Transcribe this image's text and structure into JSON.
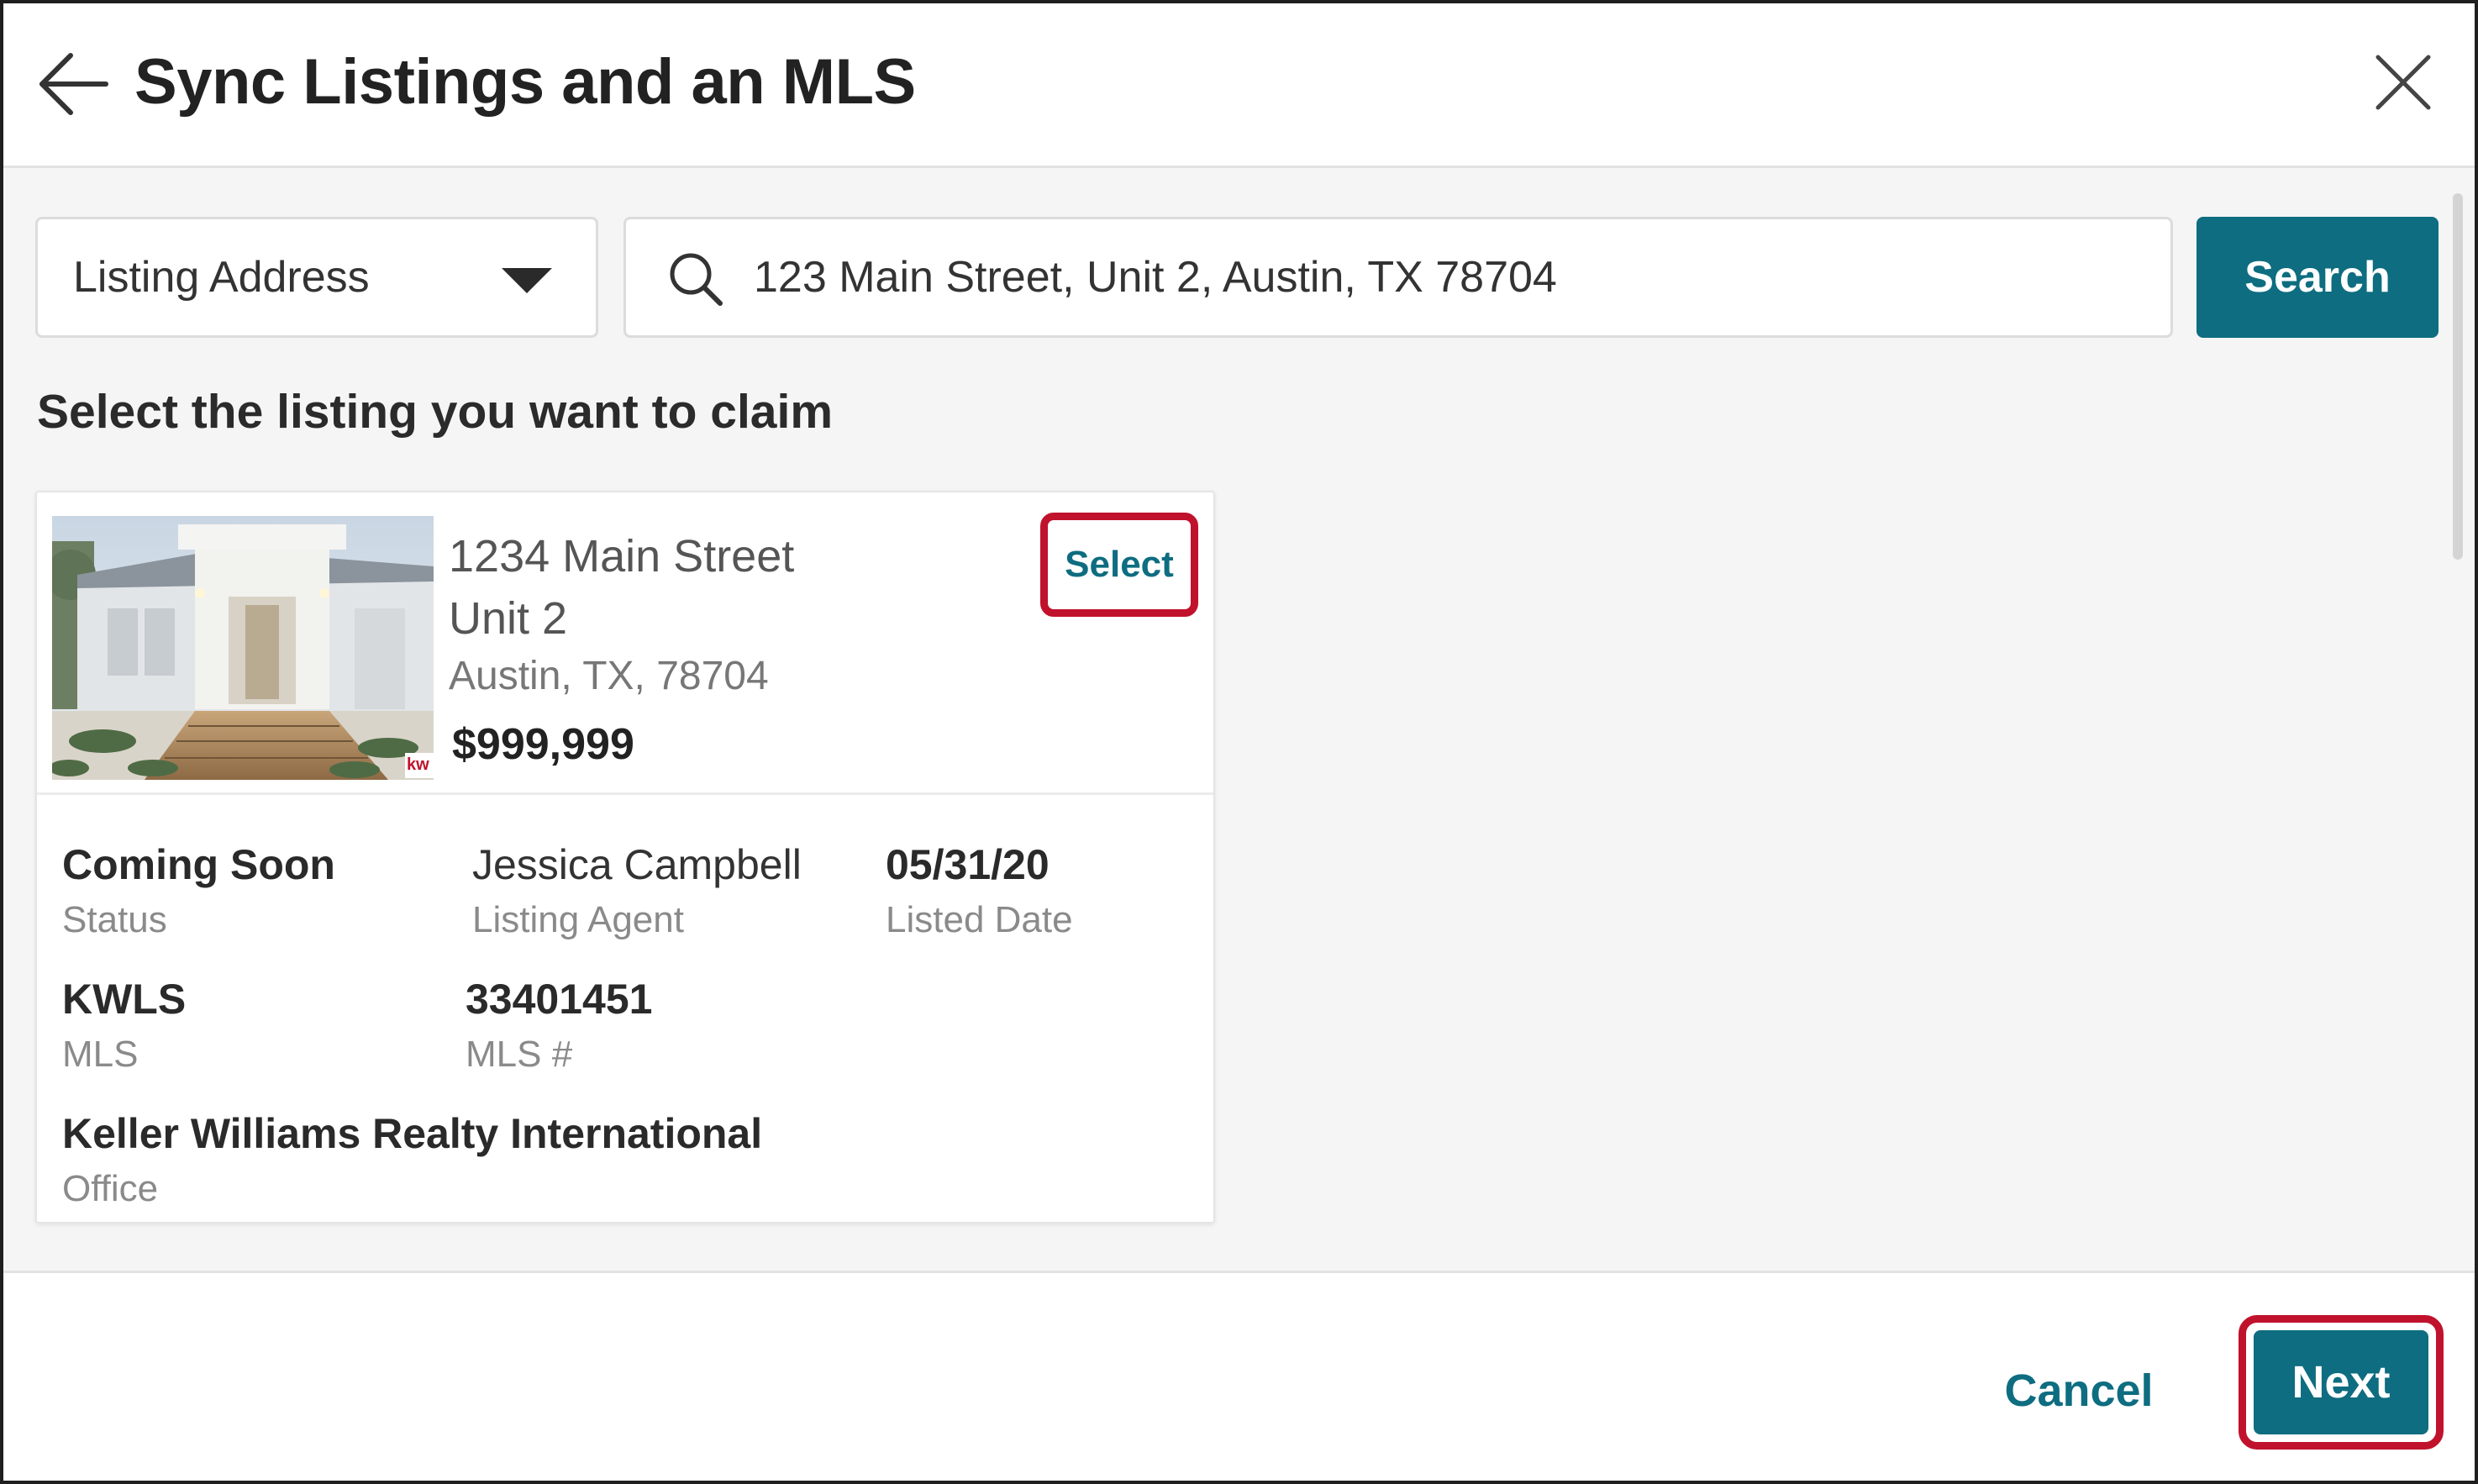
{
  "dialog": {
    "title": "Sync Listings and an MLS",
    "back_icon": "arrow-left-icon",
    "close_icon": "close-icon"
  },
  "search": {
    "filter_selected": "Listing Address",
    "query": "123 Main Street, Unit 2, Austin, TX 78704",
    "button_label": "Search"
  },
  "instruction": "Select the listing you want to claim",
  "listing": {
    "address_line1": "1234 Main Street",
    "address_line2": "Unit 2",
    "city_state_zip": "Austin, TX, 78704",
    "price": "$999,999",
    "select_label": "Select",
    "photo_badge": "kw",
    "details": {
      "status": {
        "value": "Coming Soon",
        "label": "Status"
      },
      "agent": {
        "value": "Jessica Campbell",
        "label": "Listing Agent"
      },
      "listed_date": {
        "value": "05/31/20",
        "label": "Listed Date"
      },
      "mls": {
        "value": "KWLS",
        "label": "MLS"
      },
      "mls_number": {
        "value": "33401451",
        "label": "MLS #"
      },
      "office": {
        "value": "Keller Williams Realty International",
        "label": "Office"
      }
    }
  },
  "footer": {
    "cancel_label": "Cancel",
    "next_label": "Next"
  },
  "colors": {
    "accent": "#0e6d80",
    "highlight_border": "#c0122c",
    "body_background": "#f5f5f5"
  }
}
